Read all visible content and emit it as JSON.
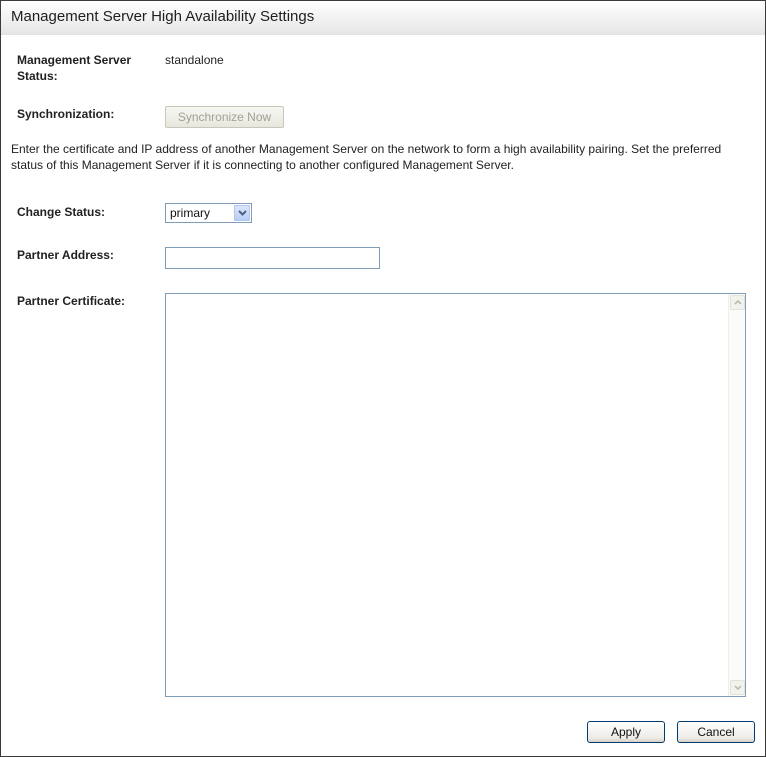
{
  "header": {
    "title": "Management Server High Availability Settings"
  },
  "status": {
    "label": "Management Server Status:",
    "value": "standalone"
  },
  "synchronization": {
    "label": "Synchronization:",
    "button_label": "Synchronize Now"
  },
  "description": "Enter the certificate and IP address of another Management Server on the network to form a high availability pairing. Set the preferred status of this Management Server if it is connecting to another configured Management Server.",
  "change_status": {
    "label": "Change Status:",
    "selected": "primary"
  },
  "partner_address": {
    "label": "Partner Address:",
    "value": ""
  },
  "partner_certificate": {
    "label": "Partner Certificate:",
    "value": ""
  },
  "actions": {
    "apply_label": "Apply",
    "cancel_label": "Cancel"
  },
  "icons": {
    "dropdown": "chevron-down-icon",
    "scroll_up": "scroll-up-arrow-icon",
    "scroll_down": "scroll-down-arrow-icon"
  },
  "colors": {
    "input_border": "#7f9db9",
    "button_border": "#003c74"
  }
}
